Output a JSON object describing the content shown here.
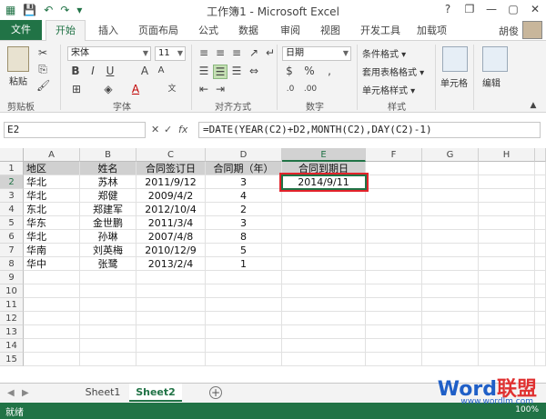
{
  "window": {
    "title": "工作簿1 - Microsoft Excel",
    "controls": [
      "?",
      "❐",
      "—",
      "▢",
      "✕"
    ]
  },
  "tabs": {
    "file": "文件",
    "items": [
      "开始",
      "插入",
      "页面布局",
      "公式",
      "数据",
      "审阅",
      "视图",
      "开发工具",
      "加载项"
    ],
    "active_index": 0,
    "user": "胡俊"
  },
  "ribbon": {
    "clipboard": {
      "label": "剪贴板",
      "paste": "粘贴"
    },
    "font": {
      "label": "字体",
      "name": "宋体",
      "size": "11"
    },
    "alignment": {
      "label": "对齐方式"
    },
    "number": {
      "label": "数字",
      "format": "日期"
    },
    "styles": {
      "label": "样式",
      "items": [
        "条件格式 ▾",
        "套用表格格式 ▾",
        "单元格样式 ▾"
      ]
    },
    "cells": {
      "label": "单元格"
    },
    "editing": {
      "label": "编辑"
    }
  },
  "formula_bar": {
    "name_box": "E2",
    "fx": "fx",
    "formula": "=DATE(YEAR(C2)+D2,MONTH(C2),DAY(C2)-1)"
  },
  "grid": {
    "columns": [
      "A",
      "B",
      "C",
      "D",
      "E",
      "F",
      "G",
      "H"
    ],
    "selected_col": "E",
    "selected_row": 2,
    "row_numbers": [
      "1",
      "2",
      "3",
      "4",
      "5",
      "6",
      "7",
      "8",
      "9",
      "10",
      "11",
      "12",
      "13",
      "14",
      "15"
    ],
    "header": [
      "地区",
      "姓名",
      "合同签订日",
      "合同期（年）",
      "合同到期日"
    ],
    "rows": [
      [
        "华北",
        "苏林",
        "2011/9/12",
        "3",
        "2014/9/11"
      ],
      [
        "华北",
        "郑健",
        "2009/4/2",
        "4",
        ""
      ],
      [
        "东北",
        "郑建军",
        "2012/10/4",
        "2",
        ""
      ],
      [
        "华东",
        "金世鹏",
        "2011/3/4",
        "3",
        ""
      ],
      [
        "华北",
        "孙琳",
        "2007/4/8",
        "8",
        ""
      ],
      [
        "华南",
        "刘英梅",
        "2010/12/9",
        "5",
        ""
      ],
      [
        "华中",
        "张鹭",
        "2013/2/4",
        "1",
        ""
      ]
    ]
  },
  "sheets": {
    "items": [
      "Sheet1",
      "Sheet2"
    ],
    "active_index": 1,
    "add": "+"
  },
  "status": {
    "text": "就绪",
    "zoom": "100%"
  },
  "watermark": {
    "word": "Word",
    "lm": "联盟",
    "url": "www.wordlm.com"
  }
}
